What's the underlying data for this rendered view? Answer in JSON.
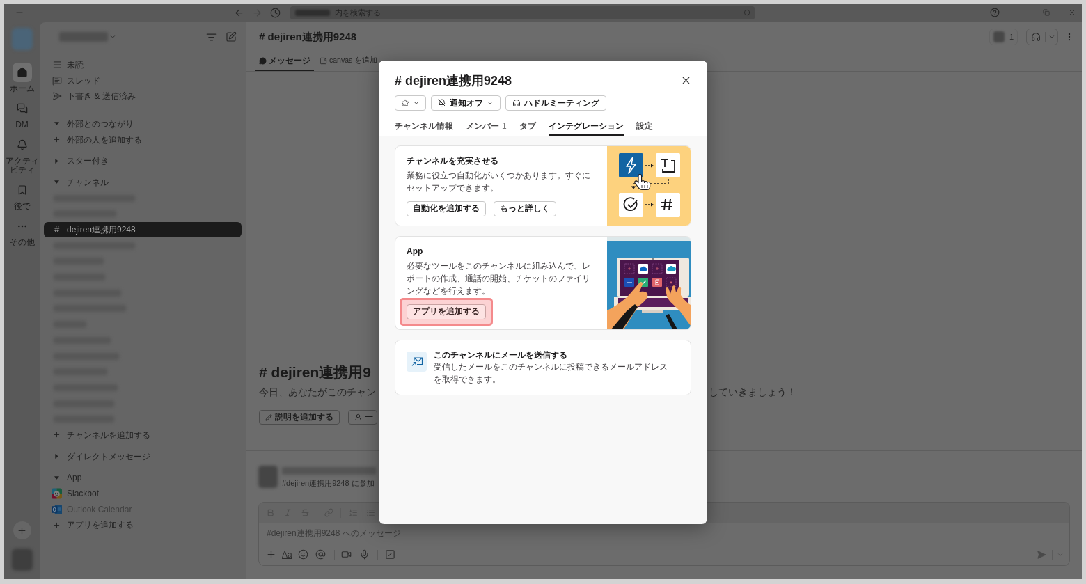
{
  "title_bar": {
    "search": {
      "placeholder": "内を検索する"
    }
  },
  "rail": {
    "items": [
      {
        "label": "ホーム",
        "selected": true
      },
      {
        "label": "DM",
        "selected": false
      },
      {
        "label": "アクティビティ",
        "selected": false
      },
      {
        "label": "後で",
        "selected": false
      },
      {
        "label": "その他",
        "selected": false
      }
    ]
  },
  "sidebar": {
    "nav": [
      {
        "label": "未読"
      },
      {
        "label": "スレッド"
      },
      {
        "label": "下書き & 送信済み"
      }
    ],
    "sections": [
      {
        "label": "外部とのつながり",
        "expanded": true,
        "items": [
          {
            "kind": "add",
            "label": "外部の人を追加する"
          }
        ]
      },
      {
        "label": "スター付き",
        "expanded": false
      },
      {
        "label": "チャンネル",
        "expanded": true,
        "items": [
          {
            "kind": "redacted",
            "selected": false
          },
          {
            "kind": "redacted",
            "selected": false
          },
          {
            "kind": "channel",
            "prefix": "#",
            "label": "dejiren連携用9248",
            "selected": true
          },
          {
            "kind": "redacted",
            "selected": false
          },
          {
            "kind": "redacted",
            "selected": false
          },
          {
            "kind": "redacted",
            "selected": false
          },
          {
            "kind": "redacted",
            "selected": false
          },
          {
            "kind": "redacted",
            "selected": false
          },
          {
            "kind": "redacted",
            "selected": false
          },
          {
            "kind": "redacted",
            "selected": false
          },
          {
            "kind": "redacted",
            "selected": false
          },
          {
            "kind": "redacted",
            "selected": false
          },
          {
            "kind": "redacted",
            "selected": false
          },
          {
            "kind": "redacted",
            "selected": false
          },
          {
            "kind": "redacted",
            "selected": false
          },
          {
            "kind": "add",
            "label": "チャンネルを追加する"
          }
        ]
      },
      {
        "label": "ダイレクトメッセージ",
        "expanded": false
      },
      {
        "label": "App",
        "expanded": true,
        "items": [
          {
            "kind": "app",
            "label": "Slackbot",
            "selected": false,
            "muted": false
          },
          {
            "kind": "app",
            "label": "Outlook Calendar",
            "selected": false,
            "muted": true
          },
          {
            "kind": "add",
            "label": "アプリを追加する"
          }
        ]
      }
    ]
  },
  "channel": {
    "title": "# dejiren連携用9248",
    "member_count": "1",
    "tabs": [
      {
        "label": "メッセージ",
        "selected": true
      },
      {
        "label": "canvas を追加",
        "selected": false
      }
    ],
    "intro": {
      "title": "# dejiren連携用9",
      "text_start": "今日、あなたがこのチャン",
      "text_end": "していきましょう！",
      "buttons": [
        {
          "label": "説明を追加する"
        },
        {
          "label": "一"
        }
      ]
    },
    "composer": {
      "join_notice": "#dejiren連携用9248 に参加",
      "placeholder": "#dejiren連携用9248 へのメッセージ",
      "format_label": "Aa"
    }
  },
  "modal": {
    "title": "# dejiren連携用9248",
    "actions": [
      {
        "kind": "dropdown",
        "label": "通知オフ"
      },
      {
        "kind": "button",
        "label": "ハドルミーティング"
      }
    ],
    "tabs": [
      {
        "label": "チャンネル情報",
        "selected": false
      },
      {
        "label": "メンバー",
        "count": "1",
        "selected": false
      },
      {
        "label": "タブ",
        "selected": false
      },
      {
        "label": "インテグレーション",
        "selected": true
      },
      {
        "label": "設定",
        "selected": false
      }
    ],
    "cards": [
      {
        "kind": "illustrated",
        "title": "チャンネルを充実させる",
        "text": "業務に役立つ自動化がいくつかあります。すぐにセットアップできます。",
        "buttons": [
          {
            "label": "自動化を追加する",
            "highlighted": false
          },
          {
            "label": "もっと詳しく",
            "highlighted": false
          }
        ]
      },
      {
        "kind": "illustrated",
        "title": "App",
        "text": "必要なツールをこのチャンネルに組み込んで、レポートの作成、通話の開始、チケットのファイリングなどを行えます。",
        "buttons": [
          {
            "label": "アプリを追加する",
            "highlighted": true
          }
        ]
      },
      {
        "kind": "icon",
        "title": "このチャンネルにメールを送信する",
        "text": "受信したメールをこのチャンネルに投稿できるメールアドレスを取得できます。"
      }
    ]
  }
}
